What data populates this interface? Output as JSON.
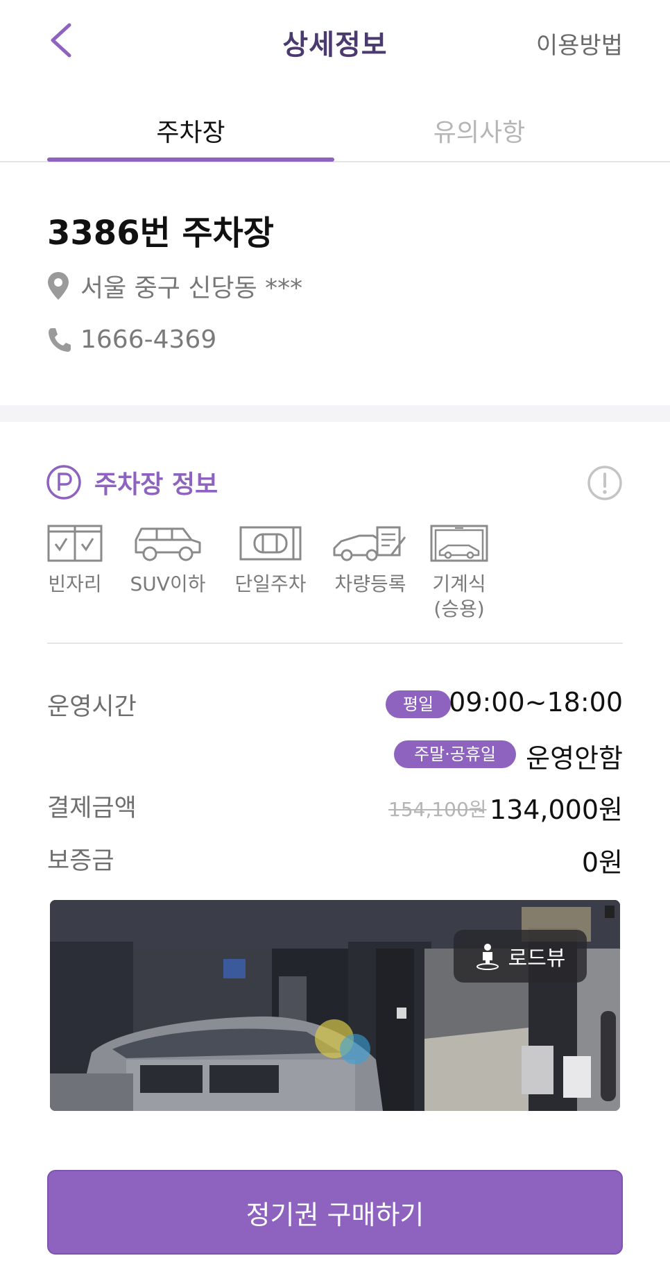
{
  "header": {
    "title": "상세정보",
    "howto_label": "이용방법",
    "back_icon": "chevron-left-icon"
  },
  "tabs": [
    {
      "label": "주차장",
      "active": true
    },
    {
      "label": "유의사항",
      "active": false
    }
  ],
  "lot": {
    "name": "3386번 주차장",
    "address": "서울 중구 신당동 ***",
    "phone": "1666-4369"
  },
  "section": {
    "title": "주차장 정보",
    "icon": "parking-circle-icon",
    "alert_icon": "exclamation-circle-icon"
  },
  "features": [
    {
      "label": "빈자리",
      "icon": "empty-spot-icon"
    },
    {
      "label": "SUV이하",
      "icon": "suv-icon"
    },
    {
      "label": "단일주차",
      "icon": "single-parking-icon"
    },
    {
      "label": "차량등록",
      "icon": "car-registration-icon"
    },
    {
      "label": "기계식\n(승용)",
      "icon": "mechanical-parking-icon"
    }
  ],
  "info": {
    "hours_label": "운영시간",
    "weekday_badge": "평일",
    "weekday_hours": "09:00~18:00",
    "weekend_badge": "주말·공휴일",
    "weekend_hours": "운영안함",
    "price_label": "결제금액",
    "original_price": "154,100원",
    "price": "134,000원",
    "deposit_label": "보증금",
    "deposit": "0원"
  },
  "roadview": {
    "label": "로드뷰",
    "icon": "pegman-icon"
  },
  "buy_button": "정기권 구매하기",
  "colors": {
    "accent": "#8e63c0",
    "title": "#4a3a6e"
  }
}
